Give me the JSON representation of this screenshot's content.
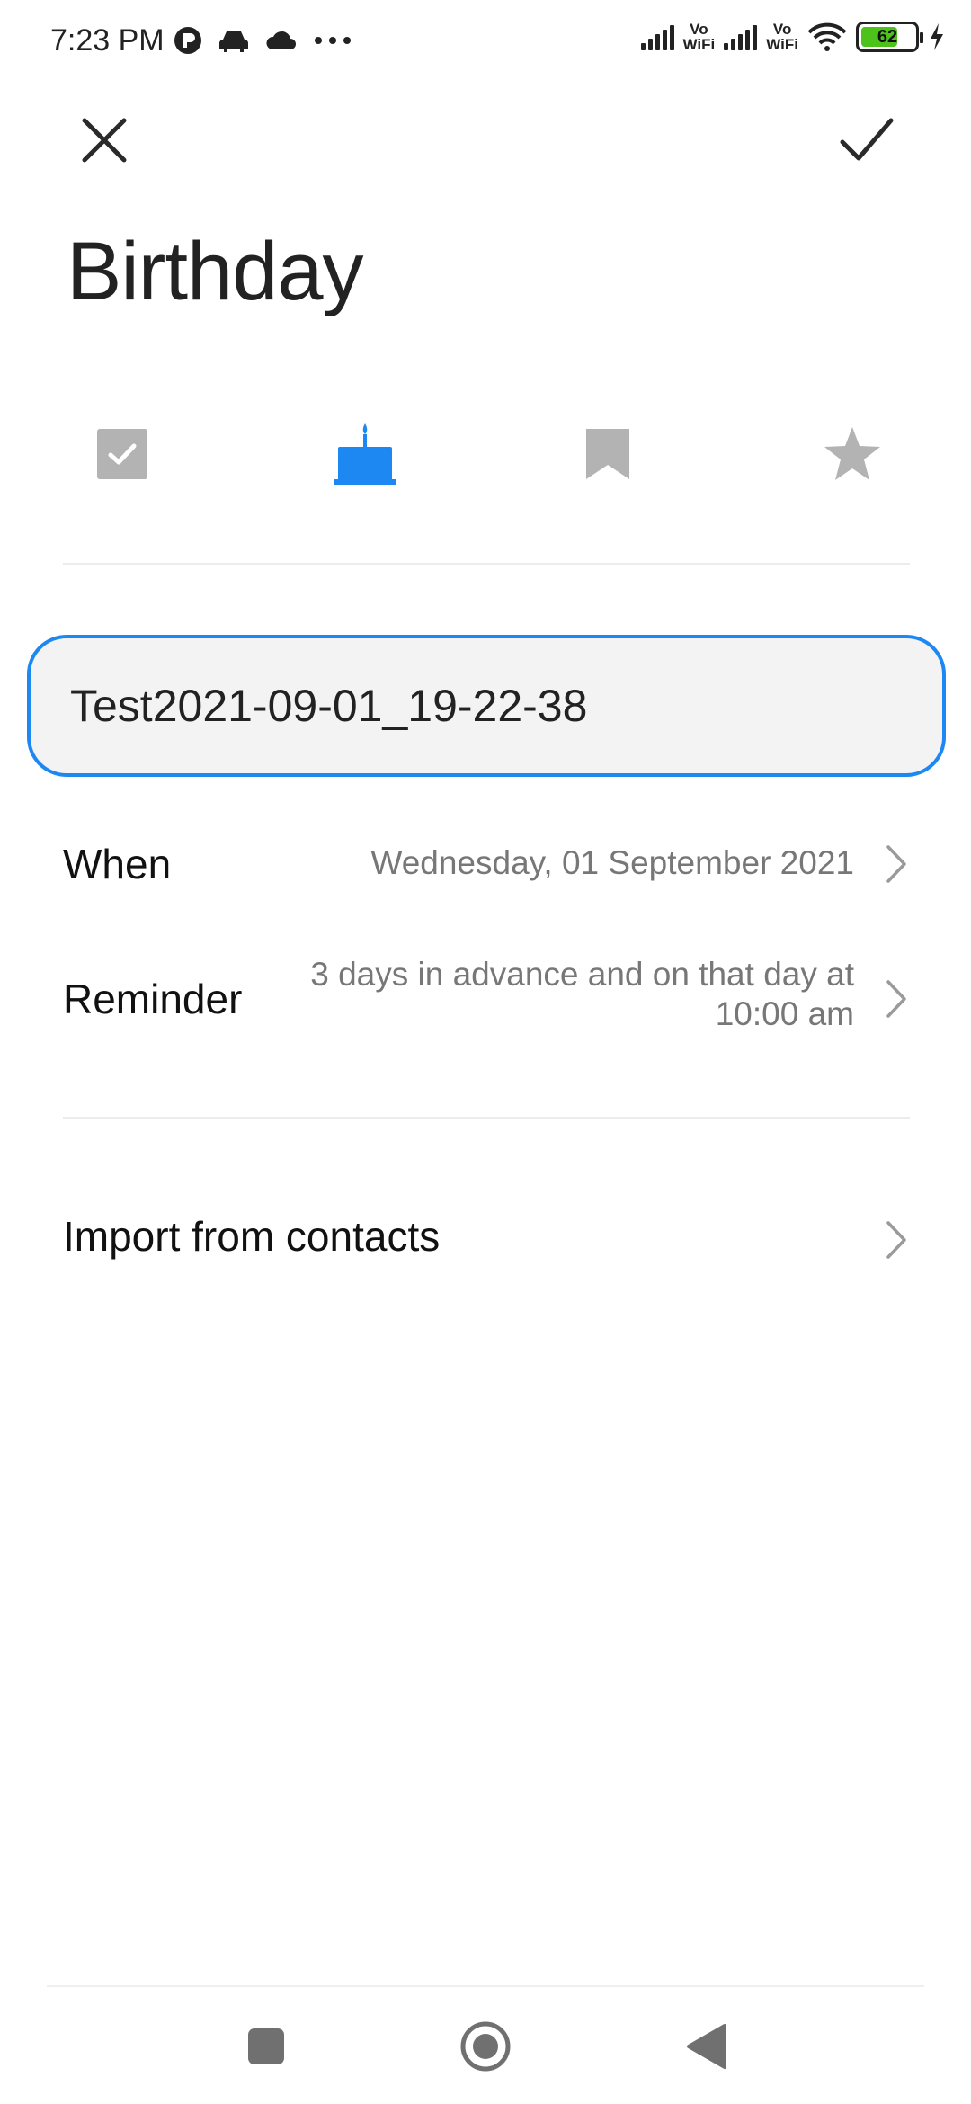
{
  "status_bar": {
    "time": "7:23 PM",
    "vowifi_1_top": "Vo",
    "vowifi_1_bottom": "WiFi",
    "vowifi_2_top": "Vo",
    "vowifi_2_bottom": "WiFi",
    "battery_level": "62"
  },
  "header": {
    "title": "Birthday"
  },
  "type_selector": {
    "options": [
      "checkbox-icon",
      "cake-icon",
      "bookmark-icon",
      "star-icon"
    ],
    "selected": "cake-icon",
    "active_color": "#1e88f2",
    "inactive_color": "#b3b3b3"
  },
  "name_field": {
    "value": "Test2021-09-01_19-22-38"
  },
  "when": {
    "label": "When",
    "value": "Wednesday, 01 September 2021"
  },
  "reminder": {
    "label": "Reminder",
    "value_line1": "3 days in advance and on that day at",
    "value_line2": "10:00 am"
  },
  "import": {
    "label": "Import from contacts"
  }
}
